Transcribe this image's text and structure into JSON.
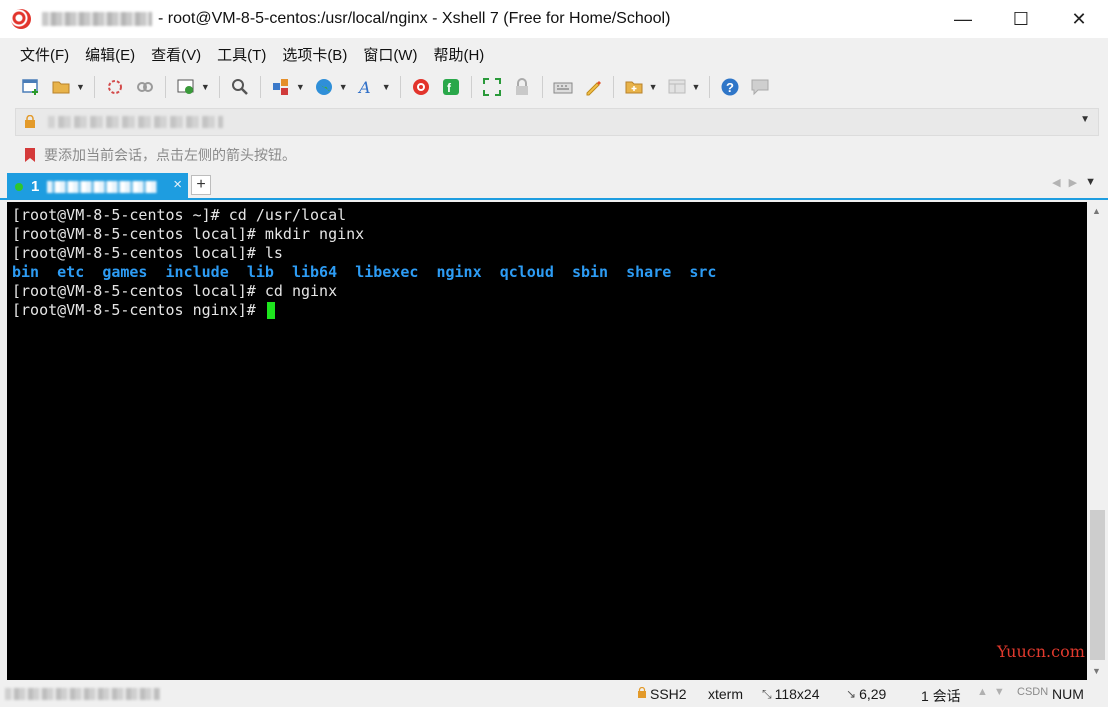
{
  "window": {
    "title": "- root@VM-8-5-centos:/usr/local/nginx - Xshell 7 (Free for Home/School)",
    "controls": {
      "minimize": "—",
      "maximize": "☐",
      "close": "✕"
    }
  },
  "menu": [
    "文件(F)",
    "编辑(E)",
    "查看(V)",
    "工具(T)",
    "选项卡(B)",
    "窗口(W)",
    "帮助(H)"
  ],
  "toolbar": {
    "icons": [
      "new-session-icon",
      "open-folder-icon",
      "reconnect-icon",
      "disconnect-icon",
      "properties-icon",
      "find-icon",
      "layout-icon",
      "globe-icon",
      "font-icon",
      "xshell-icon",
      "xftp-icon",
      "fullscreen-icon",
      "lock-icon",
      "keyboard-icon",
      "highlight-icon",
      "compose-icon",
      "pane-icon",
      "help-icon",
      "chat-icon"
    ]
  },
  "hint": {
    "text": "要添加当前会话，点击左侧的箭头按钮。"
  },
  "tab": {
    "number": "1",
    "close": "×",
    "add": "+"
  },
  "terminal": {
    "lines": [
      "[root@VM-8-5-centos ~]# cd /usr/local",
      "[root@VM-8-5-centos local]# mkdir nginx",
      "[root@VM-8-5-centos local]# ls"
    ],
    "dirs": [
      "bin",
      "etc",
      "games",
      "include",
      "lib",
      "lib64",
      "libexec",
      "nginx",
      "qcloud",
      "sbin",
      "share",
      "src"
    ],
    "lines_after": [
      "[root@VM-8-5-centos local]# cd nginx",
      "[root@VM-8-5-centos nginx]# "
    ]
  },
  "watermark": "Yuucn.com",
  "status": {
    "protocol": "SSH2",
    "terminal": "xterm",
    "size": "118x24",
    "cursor": "6,29",
    "sessions": "1 会话",
    "csdn": "CSDN",
    "num": "NUM"
  },
  "colors": {
    "accent": "#1e9de0",
    "directory": "#2d9cf4",
    "cursor": "#1ee51e",
    "watermark": "#e0392d"
  }
}
